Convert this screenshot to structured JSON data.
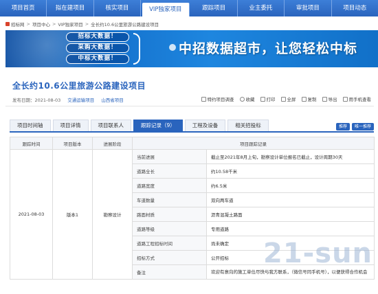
{
  "nav": {
    "items": [
      "项目首页",
      "拟在建项目",
      "核实项目",
      "VIP独家项目",
      "跟踪项目",
      "业主委托",
      "审批项目",
      "项目动态"
    ],
    "active_index": 3
  },
  "breadcrumb": [
    "招标网",
    "项目中心",
    "VIP独家项目",
    "全长约10.6公里旅游公路建设项目"
  ],
  "banner": {
    "pills": [
      "招标大数据！",
      "采购大数据！",
      "中标大数据！"
    ],
    "slogan": "中招数据超市，让您轻松中标"
  },
  "project": {
    "title": "全长约10.6公里旅游公路建设项目",
    "publish_label": "发布日期：",
    "publish_date": "2021-08-03",
    "category": "交通运输项目",
    "region": "山西省项目"
  },
  "actions": [
    "特约项目调查",
    "收藏",
    "打印",
    "全屏",
    "复制",
    "导出",
    "用手机查看"
  ],
  "tabs": [
    "项目时间轴",
    "项目详情",
    "项目联系人",
    "跟踪记录（9）",
    "工程及设备",
    "相关招投标"
  ],
  "active_tab": 3,
  "tab_buttons": [
    "推荐",
    "唯一推荐"
  ],
  "table": {
    "headers": [
      "跟踪时间",
      "项目版本",
      "进展阶段",
      "项目跟踪记录"
    ],
    "date": "2021-08-03",
    "version": "版本1",
    "stage": "勘察设计",
    "rows": [
      {
        "field": "当前进展",
        "value": "截止至2021年8月上旬，勘察设计单位报名已截止，设计周期30天"
      },
      {
        "field": "道路全长",
        "value": "约10.58千米"
      },
      {
        "field": "道路宽度",
        "value": "约6.5米"
      },
      {
        "field": "车道数量",
        "value": "双向两车道"
      },
      {
        "field": "路面材质",
        "value": "沥青混凝土路面"
      },
      {
        "field": "道路等级",
        "value": "专用道路"
      },
      {
        "field": "道路工程招标时间",
        "value": "尚未确定"
      },
      {
        "field": "招标方式",
        "value": "公开招标"
      },
      {
        "field": "备注",
        "value": "欢迎有意向的施工单位尽快与我方联系，（微信号同手机号），以便获得合作机会"
      }
    ]
  },
  "watermark": "21-sun"
}
